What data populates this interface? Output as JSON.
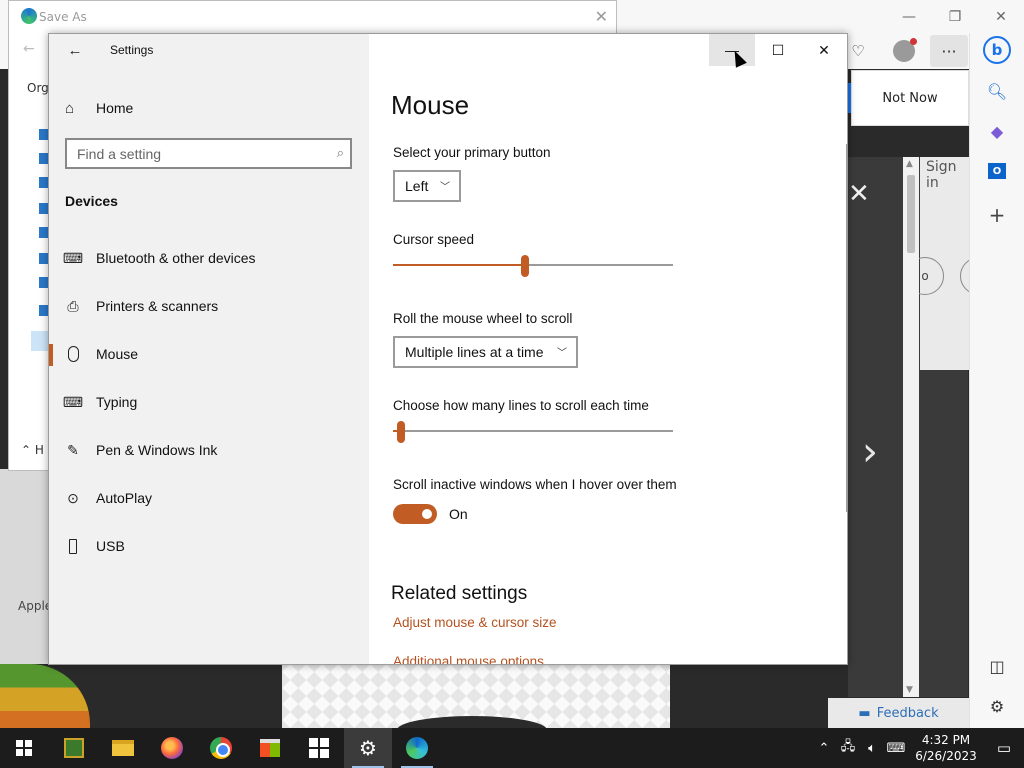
{
  "saveas": {
    "title": "Save As",
    "organize_label": "Orga",
    "hide_label": "H",
    "close_glyph": "✕"
  },
  "browser": {
    "not_now": "Not Now",
    "sign_in": "Sign in",
    "apple_label": "Apple",
    "feedback": "Feedback",
    "circle_label": "o"
  },
  "settings": {
    "app_title": "Settings",
    "home_label": "Home",
    "search_placeholder": "Find a setting",
    "category": "Devices",
    "nav": [
      {
        "label": "Bluetooth & other devices",
        "icon": "bluetooth-keyboard-icon"
      },
      {
        "label": "Printers & scanners",
        "icon": "printer-icon"
      },
      {
        "label": "Mouse",
        "icon": "mouse-icon",
        "active": true
      },
      {
        "label": "Typing",
        "icon": "keyboard-icon"
      },
      {
        "label": "Pen & Windows Ink",
        "icon": "pen-icon"
      },
      {
        "label": "AutoPlay",
        "icon": "autoplay-icon"
      },
      {
        "label": "USB",
        "icon": "usb-icon"
      }
    ],
    "page_title": "Mouse",
    "primary_button": {
      "label": "Select your primary button",
      "value": "Left"
    },
    "cursor_speed": {
      "label": "Cursor speed",
      "value_fraction": 0.47
    },
    "wheel_scroll": {
      "label": "Roll the mouse wheel to scroll",
      "value": "Multiple lines at a time"
    },
    "scroll_lines": {
      "label": "Choose how many lines to scroll each time",
      "value_fraction": 0.03
    },
    "inactive_scroll": {
      "label": "Scroll inactive windows when I hover over them",
      "state": "On"
    },
    "related_title": "Related settings",
    "links": [
      "Adjust mouse & cursor size",
      "Additional mouse options"
    ],
    "accent_color": "#c25c25"
  },
  "taskbar": {
    "time": "4:32 PM",
    "date": "6/26/2023"
  }
}
